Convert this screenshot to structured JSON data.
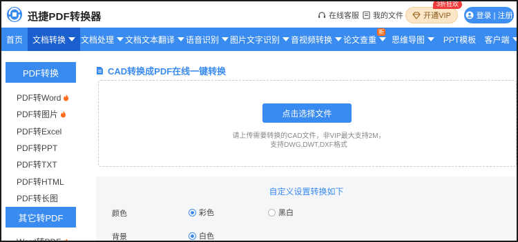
{
  "app": {
    "brand": "迅捷PDF转换器"
  },
  "header": {
    "service_label": "在线客服",
    "files_label": "我的文件",
    "vip_label": "开通VIP",
    "vip_badge": "3折狂欢",
    "login_label": "登录 | 注册"
  },
  "nav": {
    "items": [
      {
        "label": "首页",
        "dropdown": false,
        "active": false
      },
      {
        "label": "文档转换",
        "dropdown": true,
        "active": true
      },
      {
        "label": "文档处理",
        "dropdown": true,
        "active": false
      },
      {
        "label": "文档文本翻译",
        "dropdown": true,
        "active": false
      },
      {
        "label": "语音识别",
        "dropdown": true,
        "active": false
      },
      {
        "label": "图片文字识别",
        "dropdown": true,
        "active": false
      },
      {
        "label": "音视频转换",
        "dropdown": true,
        "active": false
      },
      {
        "label": "论文查重",
        "dropdown": true,
        "active": false,
        "badge": "新"
      },
      {
        "label": "思维导图",
        "dropdown": true,
        "active": false
      },
      {
        "label": "PPT模板",
        "dropdown": false,
        "active": false
      },
      {
        "label": "客户端",
        "dropdown": true,
        "active": false
      }
    ]
  },
  "sidebar": {
    "section1_title": "PDF转换",
    "section1_items": [
      {
        "label": "PDF转Word",
        "hot": true
      },
      {
        "label": "PDF转图片",
        "hot": true
      },
      {
        "label": "PDF转Excel",
        "hot": false
      },
      {
        "label": "PDF转PPT",
        "hot": false
      },
      {
        "label": "PDF转TXT",
        "hot": false
      },
      {
        "label": "PDF转HTML",
        "hot": false
      },
      {
        "label": "PDF转长图",
        "hot": false
      }
    ],
    "section2_title": "其它转PDF",
    "section2_items": [
      {
        "label": "Word转PDF",
        "hot": true
      }
    ]
  },
  "main": {
    "title": "CAD转换成PDF在线一键转换",
    "upload_button": "点击选择文件",
    "upload_note_line1": "请上传需要转换的CAD文件，非VIP最大支持2M，",
    "upload_note_line2": "支持DWG,DWT,DXF格式"
  },
  "settings": {
    "title": "自定义设置转换如下",
    "color_label": "颜色",
    "color_options": [
      {
        "label": "彩色",
        "selected": true
      },
      {
        "label": "黑白",
        "selected": false
      }
    ],
    "background_label": "背景",
    "background_options": [
      {
        "label": "白色",
        "selected": true
      }
    ]
  },
  "colors": {
    "accent": "#3a8bf0",
    "nav_active": "#1b5fcf",
    "hot": "#ff6b1a"
  },
  "icons": [
    "logo-icon",
    "headset-icon",
    "file-icon",
    "diamond-icon",
    "user-icon",
    "caret-down-icon",
    "document-icon",
    "fire-icon"
  ]
}
